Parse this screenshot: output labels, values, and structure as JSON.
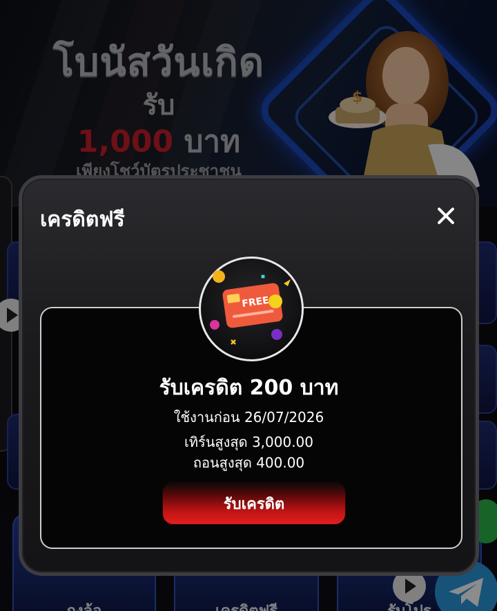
{
  "banner": {
    "title": "โบนัสวันเกิด",
    "line2": "รับ",
    "amount": "1,000",
    "currency": "บาท",
    "line4": "เพียงโชว์บัตรประชาชน"
  },
  "bottom_nav": {
    "items": [
      {
        "label": "กงล้อ"
      },
      {
        "label": "เครดิตฟรี"
      },
      {
        "label": "รับโปร"
      }
    ]
  },
  "modal": {
    "title": "เครดิตฟรี",
    "badge_text": "FREE",
    "reward_title": "รับเครดิต 200 บาท",
    "expiry": "ใช้งานก่อน 26/07/2026",
    "turnover": "เทิร์นสูงสุด 3,000.00",
    "withdraw": "ถอนสูงสุด 400.00",
    "claim_label": "รับเครดิต"
  },
  "colors": {
    "accent_red": "#e02020",
    "banner_amount_red": "#c81e2b",
    "modal_bg": "#1b1b1e",
    "card_border": "#cfcfcf"
  }
}
